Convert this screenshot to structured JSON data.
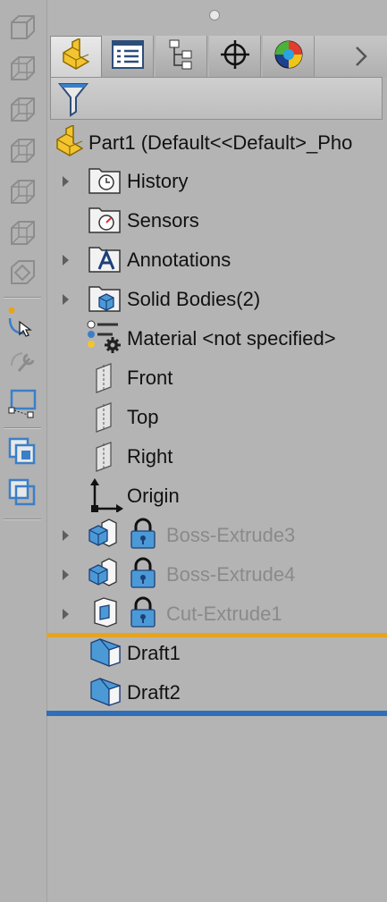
{
  "colors": {
    "panel_background": "#b4b4b4",
    "rollback_bar": "#e6a41d",
    "end_bar": "#2f6fb8",
    "suppressed_text": "#8a8a8a",
    "feature_blue": "#4b9ad6",
    "part_yellow": "#f4c430"
  },
  "tabs": [
    {
      "name": "FeatureManager",
      "icon": "part-icon",
      "active": true
    },
    {
      "name": "PropertyManager",
      "icon": "property-list-icon",
      "active": false
    },
    {
      "name": "ConfigurationManager",
      "icon": "configuration-tree-icon",
      "active": false
    },
    {
      "name": "DimXpertManager",
      "icon": "crosshair-icon",
      "active": false
    },
    {
      "name": "DisplayManager",
      "icon": "appearance-sphere-icon",
      "active": false
    }
  ],
  "left_toolbar": [
    "cube-front-view-icon",
    "cube-back-view-icon",
    "cube-left-view-icon",
    "cube-right-view-icon",
    "cube-top-view-icon",
    "cube-bottom-view-icon",
    "isometric-view-icon",
    "select-icon",
    "wrench-icon",
    "selection-box-icon",
    "copy-layers-icon",
    "overlap-layers-icon"
  ],
  "tree": {
    "root_label": "Part1  (Default<<Default>_Pho",
    "root_icon": "part-icon",
    "items": [
      {
        "label": "History",
        "icon": "history-folder-icon",
        "expandable": true
      },
      {
        "label": "Sensors",
        "icon": "sensors-folder-icon",
        "expandable": false
      },
      {
        "label": "Annotations",
        "icon": "annotations-folder-icon",
        "expandable": true
      },
      {
        "label": "Solid Bodies(2)",
        "icon": "solid-bodies-folder-icon",
        "expandable": true
      },
      {
        "label": "Material <not specified>",
        "icon": "material-icon",
        "expandable": false
      },
      {
        "label": "Front",
        "icon": "plane-icon",
        "expandable": false
      },
      {
        "label": "Top",
        "icon": "plane-icon",
        "expandable": false
      },
      {
        "label": "Right",
        "icon": "plane-icon",
        "expandable": false
      },
      {
        "label": "Origin",
        "icon": "origin-axes-icon",
        "expandable": false
      },
      {
        "label": "Boss-Extrude3",
        "icon": "boss-extrude-icon",
        "expandable": true,
        "locked": true
      },
      {
        "label": "Boss-Extrude4",
        "icon": "boss-extrude-icon",
        "expandable": true,
        "locked": true
      },
      {
        "label": "Cut-Extrude1",
        "icon": "cut-extrude-icon",
        "expandable": true,
        "locked": true
      },
      {
        "label": "Draft1",
        "icon": "draft-feature-icon",
        "expandable": false
      },
      {
        "label": "Draft2",
        "icon": "draft-feature-icon",
        "expandable": false
      }
    ]
  }
}
